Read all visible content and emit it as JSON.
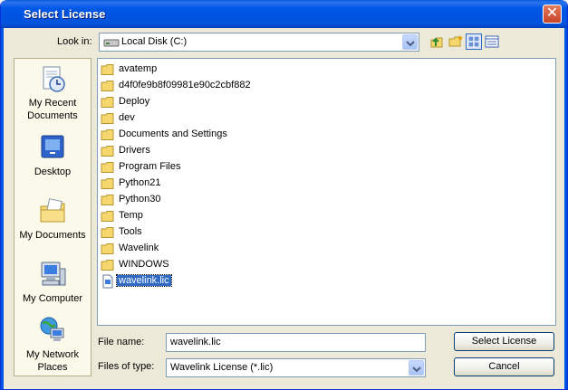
{
  "dialog": {
    "title": "Select License",
    "close_symbol": "✕"
  },
  "lookin": {
    "label": "Look in:",
    "value": "Local Disk (C:)"
  },
  "places": [
    {
      "label": "My Recent Documents",
      "icon": "recent-documents-icon"
    },
    {
      "label": "Desktop",
      "icon": "desktop-icon"
    },
    {
      "label": "My Documents",
      "icon": "my-documents-icon"
    },
    {
      "label": "My Computer",
      "icon": "my-computer-icon"
    },
    {
      "label": "My Network Places",
      "icon": "network-places-icon"
    }
  ],
  "files": [
    {
      "name": "avatemp",
      "type": "folder"
    },
    {
      "name": "d4f0fe9b8f09981e90c2cbf882",
      "type": "folder"
    },
    {
      "name": "Deploy",
      "type": "folder"
    },
    {
      "name": "dev",
      "type": "folder"
    },
    {
      "name": "Documents and Settings",
      "type": "folder"
    },
    {
      "name": "Drivers",
      "type": "folder"
    },
    {
      "name": "Program Files",
      "type": "folder"
    },
    {
      "name": "Python21",
      "type": "folder"
    },
    {
      "name": "Python30",
      "type": "folder"
    },
    {
      "name": "Temp",
      "type": "folder"
    },
    {
      "name": "Tools",
      "type": "folder"
    },
    {
      "name": "Wavelink",
      "type": "folder"
    },
    {
      "name": "WINDOWS",
      "type": "folder"
    },
    {
      "name": "wavelink.lic",
      "type": "file",
      "selected": true
    }
  ],
  "filename": {
    "label": "File name:",
    "value": "wavelink.lic"
  },
  "filetype": {
    "label": "Files of type:",
    "value": "Wavelink License (*.lic)"
  },
  "buttons": {
    "select": "Select License",
    "cancel": "Cancel"
  },
  "colors": {
    "title_bar": "#0058e6",
    "dialog_bg": "#ece9d8",
    "selection": "#316ac5"
  }
}
